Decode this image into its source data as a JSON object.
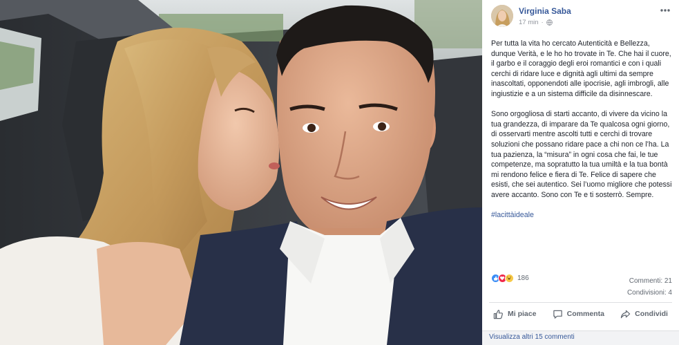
{
  "post": {
    "author": "Virginia Saba",
    "time": "17 min",
    "privacy_icon": "globe-icon",
    "more_icon": "more-options-icon",
    "paragraphs": [
      "Per tutta la vita ho cercato Autenticità e Bellezza, dunque Verità, e le ho ho trovate in Te. Che hai il cuore, il garbo e il coraggio degli eroi romantici e con i quali cerchi di ridare luce e dignità agli ultimi da sempre inascoltati, opponendoti alle ipocrisie, agli imbrogli, alle ingiustizie e a un sistema difficile da disinnescare.",
      "Sono orgogliosa di starti accanto, di vivere da vicino la tua grandezza, di imparare da Te qualcosa ogni giorno, di osservarti mentre ascolti tutti e cerchi di trovare soluzioni che possano ridare pace a chi non ce l’ha. La tua pazienza, la “misura” in ogni cosa che fai, le tue competenze, ma sopratutto la tua umiltà e la tua bontà mi rendono felice e fiera di Te. Felice di sapere che esisti, che sei autentico. Sei l’uomo migliore che potessi avere accanto. Sono con Te e ti sosterrò. Sempre."
    ],
    "hashtag": "#lacittàideale"
  },
  "reactions": {
    "count": "186",
    "icons": [
      "like-reaction-icon",
      "love-reaction-icon",
      "haha-reaction-icon"
    ]
  },
  "stats": {
    "comments": "Commenti: 21",
    "shares": "Condivisioni: 4"
  },
  "actions": {
    "like": "Mi piace",
    "comment": "Commenta",
    "share": "Condividi"
  },
  "comments_link": "Visualizza altri 15 commenti",
  "colors": {
    "link": "#365899",
    "text": "#1d2129",
    "muted": "#606770",
    "divider": "#dddfe2"
  }
}
